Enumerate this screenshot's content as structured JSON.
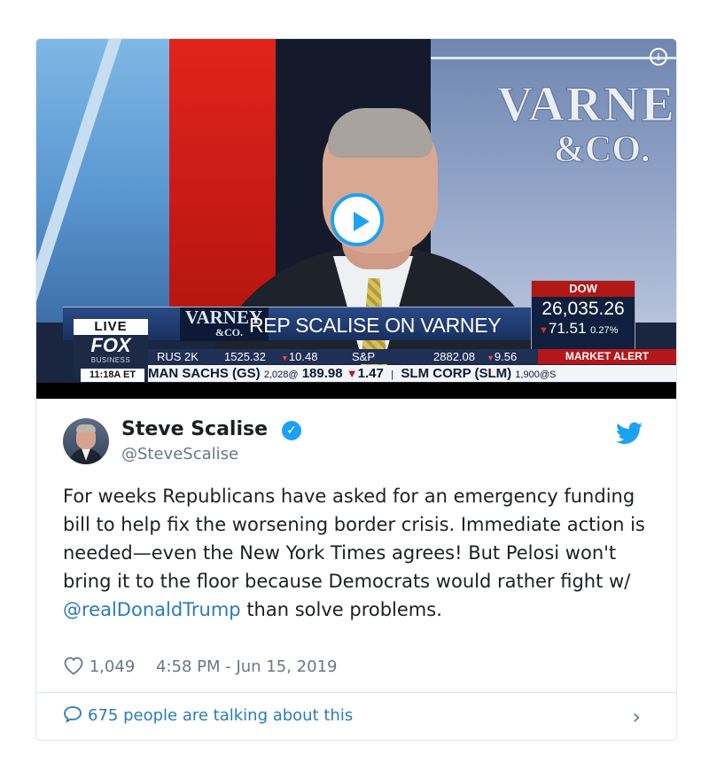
{
  "video": {
    "show_logo_line1": "VARNE",
    "show_logo_line2": "&CO.",
    "live_label": "LIVE",
    "network_logo": "FOX",
    "network_sub": "BUSINESS",
    "time": "11:18A ET",
    "banner_show_line1": "VARNEY",
    "banner_show_line2": "&CO.",
    "banner_text": "REP SCALISE ON VARNEY",
    "dow": {
      "title": "DOW",
      "value": "26,035.26",
      "change": "71.51",
      "change_pct": "0.27%"
    },
    "ticker_top": [
      {
        "label": "RUS 2K",
        "value": "1525.32",
        "change": "10.48"
      },
      {
        "label": "S&P",
        "value": "2882.08",
        "change": "9.56"
      }
    ],
    "market_alert": "MARKET ALERT",
    "ticker_bottom": {
      "t1": "MAN SACHS (GS)",
      "t1_shares": "2,028@",
      "t1_price": "189.98",
      "t1_change": "1.47",
      "sep": "|",
      "t2": "SLM CORP (SLM)",
      "t2_shares": "1,900@",
      "t2_price": "S"
    },
    "play_icon": "play-icon",
    "info_icon": "info-icon"
  },
  "tweet": {
    "author_name": "Steve Scalise",
    "author_handle": "@SteveScalise",
    "text_before": "For weeks Republicans have asked for an emergency funding bill to help fix the worsening border crisis. Immediate action is needed—even the New York Times agrees! But Pelosi won't bring it to the floor because Democrats would rather fight w/ ",
    "mention": "@realDonaldTrump",
    "text_after": " than solve problems.",
    "likes": "1,049",
    "timestamp": "4:58 PM - Jun 15, 2019",
    "talking": "675 people are talking about this"
  },
  "colors": {
    "link": "#2b7bb9",
    "twitter_blue": "#1da1f2",
    "muted": "#697882",
    "text": "#1c2022"
  }
}
